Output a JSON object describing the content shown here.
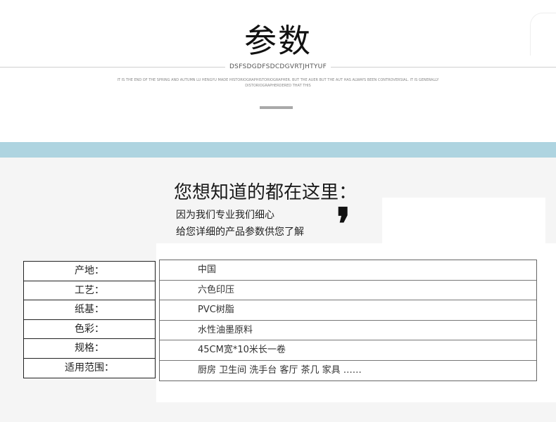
{
  "header": {
    "title": "参数",
    "subtitle": "DSFSDGDFSDCDGVRTJHTYUF",
    "fine_print": "IT IS THE END OF THE SPRING AND AUTUMN LU HENGYU MADE HISTORIOGRAPHISTORIOGRAPHER. BUT THE AUER BUT THE AUT HAS ALWAYS BEEN CONTROVERSIAL. IT IS GENERALLY DISTORIOGRAPHERDERED THAT THIS"
  },
  "intro": {
    "headline": "您想知道的都在这里：",
    "line1": "因为我们专业我们细心",
    "line2": "给您详细的产品参数供您了解",
    "mark": "❜"
  },
  "specs": [
    {
      "label": "产地：",
      "value": "中国"
    },
    {
      "label": "工艺：",
      "value": "六色印压"
    },
    {
      "label": "纸基：",
      "value": "PVC树脂"
    },
    {
      "label": "色彩：",
      "value": "水性油墨原料"
    },
    {
      "label": "规格：",
      "value": "45CM宽*10米长一卷"
    },
    {
      "label": "适用范围：",
      "value": "厨房 卫生间 洗手台 客厅 茶几 家具 ……"
    }
  ],
  "colors": {
    "band": "#aed4e0",
    "background": "#f5f5f5"
  }
}
